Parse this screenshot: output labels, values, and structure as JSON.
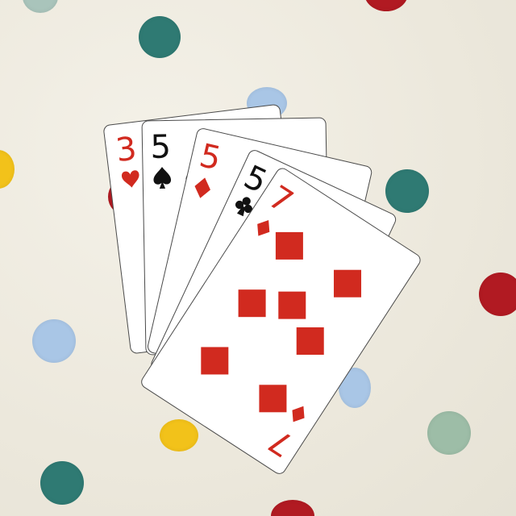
{
  "scene": {
    "background_color": "#ece9df",
    "dot_colors": {
      "teal": "#2f7a73",
      "red": "#b11a22",
      "yellow": "#f2c21a",
      "light_blue": "#a9c6e6",
      "sage": "#9dbda7"
    }
  },
  "cards": [
    {
      "rank": "3",
      "suit": "hearts",
      "color": "#d12a1f"
    },
    {
      "rank": "5",
      "suit": "spades",
      "color": "#111111"
    },
    {
      "rank": "5",
      "suit": "diamonds",
      "color": "#d12a1f"
    },
    {
      "rank": "5",
      "suit": "clubs",
      "color": "#111111"
    },
    {
      "rank": "7",
      "suit": "diamonds",
      "color": "#d12a1f"
    }
  ],
  "icons": {
    "heart": "heart-icon",
    "spade": "spade-icon",
    "diamond": "diamond-icon",
    "club": "club-icon"
  }
}
